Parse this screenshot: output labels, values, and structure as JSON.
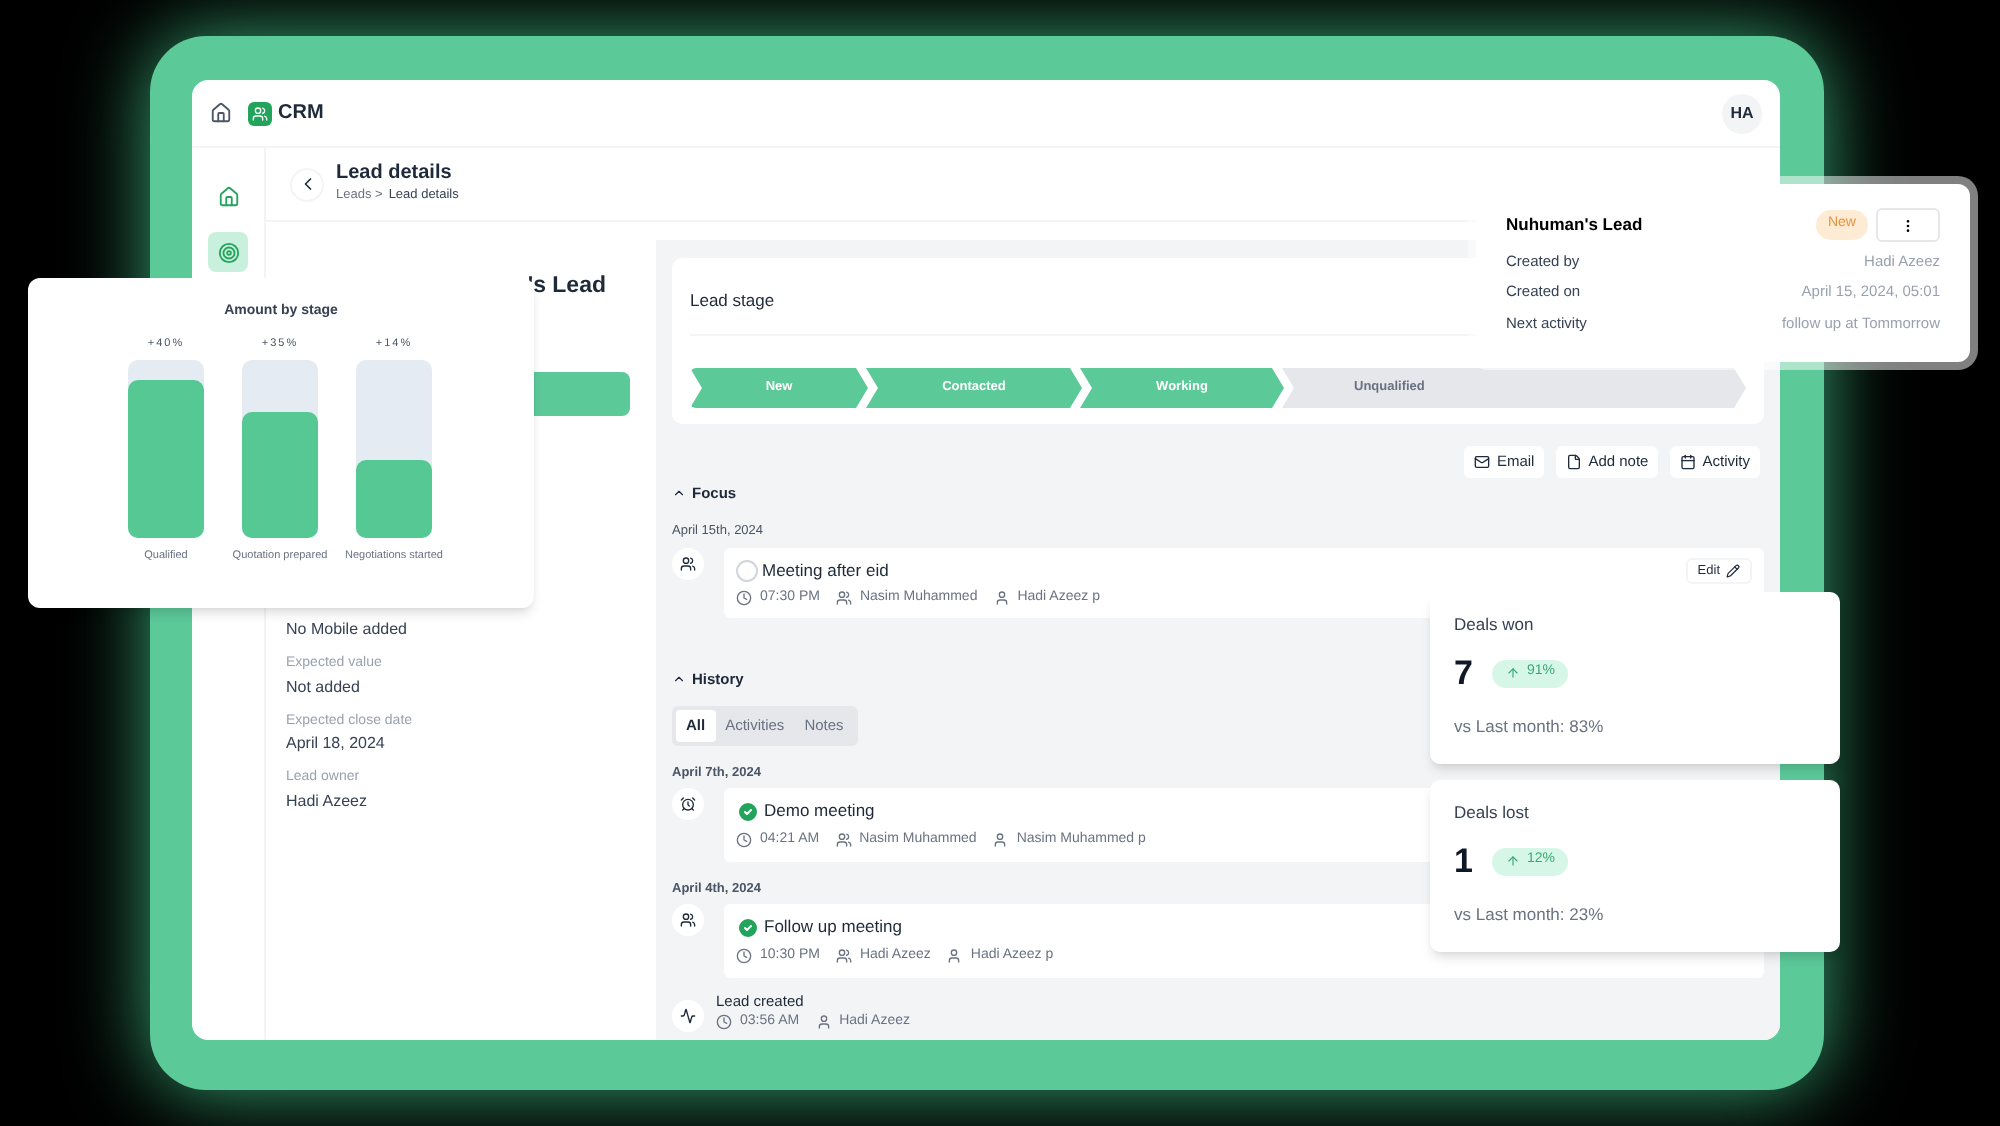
{
  "app": {
    "name": "CRM",
    "avatar": "HA"
  },
  "sidebar": {
    "items": [
      {
        "selected": false
      },
      {
        "selected": true
      }
    ]
  },
  "header": {
    "title": "Lead details",
    "breadcrumb": [
      "Leads >",
      "Lead details"
    ]
  },
  "lead_panel": {
    "title_visible": "'s Lead",
    "fields": [
      {
        "value": "No Mobile added"
      },
      {
        "label": "Expected value",
        "value": "Not added"
      },
      {
        "label": "Expected close date",
        "value": "April 18, 2024"
      },
      {
        "label": "Lead owner",
        "value": "Hadi Azeez"
      }
    ]
  },
  "lead_stage": {
    "title": "Lead stage",
    "stages": [
      {
        "label": "New",
        "completed": true
      },
      {
        "label": "Contacted",
        "completed": true
      },
      {
        "label": "Working",
        "completed": true
      },
      {
        "label": "Unqualified",
        "completed": false
      }
    ]
  },
  "actions": [
    {
      "label": "Email"
    },
    {
      "label": "Add note"
    },
    {
      "label": "Activity"
    }
  ],
  "focus": {
    "title": "Focus",
    "date": "April 15th, 2024",
    "item": {
      "title": "Meeting after eid",
      "done": false,
      "time": "07:30 PM",
      "attendee": "Nasim Muhammed",
      "owner": "Hadi Azeez p",
      "edit": "Edit"
    }
  },
  "history": {
    "title": "History",
    "tabs": [
      {
        "label": "All",
        "selected": true
      },
      {
        "label": "Activities",
        "selected": false
      },
      {
        "label": "Notes",
        "selected": false
      }
    ],
    "groups": [
      {
        "date": "April 7th, 2024",
        "title": "Demo meeting",
        "done": true,
        "time": "04:21 AM",
        "attendee": "Nasim Muhammed",
        "owner": "Nasim Muhammed p"
      },
      {
        "date": "April 4th, 2024",
        "title": "Follow up meeting",
        "done": true,
        "time": "10:30 PM",
        "attendee": "Hadi Azeez",
        "owner": "Hadi Azeez p"
      }
    ],
    "created": {
      "title": "Lead created",
      "time": "03:56 AM",
      "owner": "Hadi Azeez"
    }
  },
  "lead_card": {
    "title": "Nuhuman's Lead",
    "badge": "New",
    "rows": [
      {
        "label": "Created by",
        "value": "Hadi Azeez"
      },
      {
        "label": "Created on",
        "value": "April 15, 2024, 05:01"
      },
      {
        "label": "Next activity",
        "value": "follow up at Tommorrow"
      }
    ]
  },
  "stage_chart": {
    "title": "Amount by stage",
    "bars": [
      {
        "label": "Qualified",
        "change": "+40%",
        "level": 0.88
      },
      {
        "label": "Quotation prepared",
        "change": "+35%",
        "level": 0.7
      },
      {
        "label": "Negotiations started",
        "change": "+14%",
        "level": 0.43
      }
    ]
  },
  "stats": [
    {
      "title": "Deals won",
      "value": "7",
      "change": "91%",
      "comparison": "vs Last month: 83%"
    },
    {
      "title": "Deals lost",
      "value": "1",
      "change": "12%",
      "comparison": "vs Last month: 23%"
    }
  ]
}
